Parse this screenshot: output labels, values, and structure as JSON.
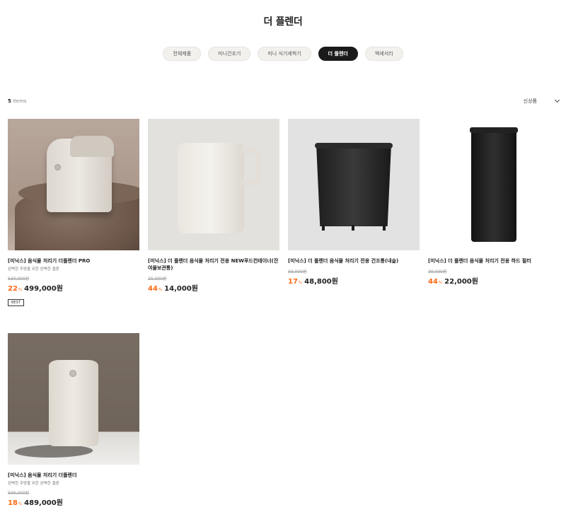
{
  "page": {
    "title": "더 플렌더"
  },
  "tabs": [
    {
      "label": "전체제품",
      "active": false
    },
    {
      "label": "미니건조기",
      "active": false
    },
    {
      "label": "미니 식기세척기",
      "active": false
    },
    {
      "label": "더 플렌더",
      "active": true
    },
    {
      "label": "액세서리",
      "active": false
    }
  ],
  "toolbar": {
    "count_num": "5",
    "count_unit": " items",
    "sort_label": "신상품"
  },
  "products": [
    {
      "name": "[미닉스] 음식물 처리기 더플렌더 PRO",
      "desc": "완벽한 주방을 위한 완벽한 결론",
      "original_price": "630,000원",
      "discount": "22",
      "pct": "%",
      "price": "499,000원",
      "badge": "BEST"
    },
    {
      "name": "[미닉스] 더 플렌더 음식물 처리기 전용 NEW푸드컨테이너(잔여물보관통)",
      "desc": "",
      "original_price": "25,000원",
      "discount": "44",
      "pct": "%",
      "price": "14,000원",
      "badge": ""
    },
    {
      "name": "[미닉스] 더 플렌더 음식물 처리기 전용 건조통(내솥)",
      "desc": "",
      "original_price": "59,000원",
      "discount": "17",
      "pct": "%",
      "price": "48,800원",
      "badge": ""
    },
    {
      "name": "[미닉스] 더 플렌더 음식물 처리기 전용 하드 필터",
      "desc": "",
      "original_price": "39,000원",
      "discount": "44",
      "pct": "%",
      "price": "22,000원",
      "badge": ""
    },
    {
      "name": "[미닉스] 음식물 처리기 더플렌더",
      "desc": "완벽한 주방을 위한 완벽한 결론",
      "original_price": "599,000원",
      "discount": "18",
      "pct": "%",
      "price": "489,000원",
      "badge": ""
    }
  ],
  "colors": {
    "accent_orange": "#ff6a13",
    "active_tab": "#1a1a1a"
  }
}
